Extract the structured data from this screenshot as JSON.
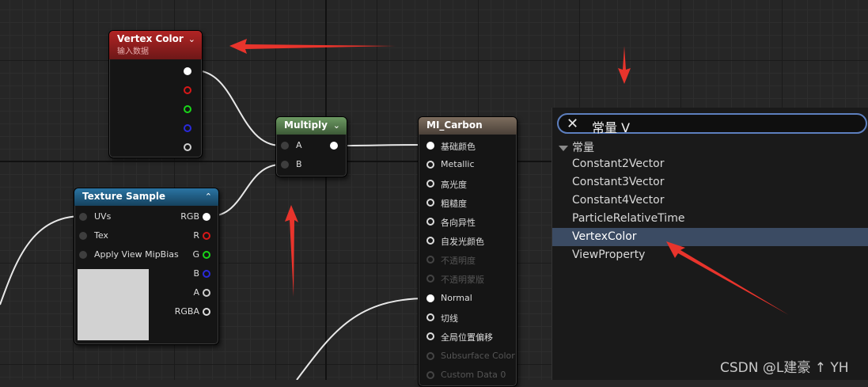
{
  "nodes": {
    "vertex_color": {
      "title": "Vertex Color",
      "subtitle": "输入数据",
      "header_color": "#9a1d1d"
    },
    "multiply": {
      "title": "Multiply",
      "pin_a": "A",
      "pin_b": "B",
      "header_color": "#557a4c"
    },
    "texture_sample": {
      "title": "Texture Sample",
      "header_color": "#1f5f85",
      "inputs": [
        "UVs",
        "Tex",
        "Apply View MipBias"
      ],
      "outputs": [
        "RGB",
        "R",
        "G",
        "B",
        "A",
        "RGBA"
      ]
    },
    "material": {
      "title": "MI_Carbon",
      "header_color": "#6b5d50",
      "inputs": [
        "基础颜色",
        "Metallic",
        "高光度",
        "粗糙度",
        "各向异性",
        "自发光颜色",
        "不透明度",
        "不透明蒙版",
        "Normal",
        "切线",
        "全局位置偏移",
        "Subsurface Color",
        "Custom Data 0"
      ]
    }
  },
  "search": {
    "query": "常量 V",
    "category": "常量",
    "items": [
      "Constant2Vector",
      "Constant3Vector",
      "Constant4Vector",
      "ParticleRelativeTime",
      "VertexColor",
      "ViewProperty"
    ],
    "selected": "VertexColor"
  },
  "watermark": "CSDN @L建豪 ↑ YH"
}
